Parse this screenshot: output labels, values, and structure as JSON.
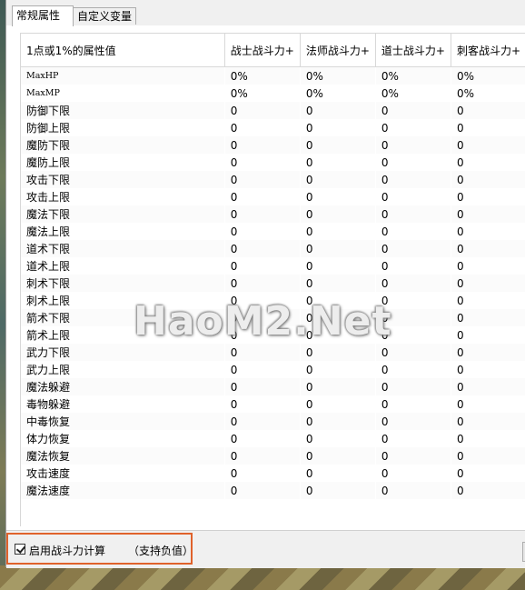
{
  "tabs": [
    {
      "label": "常规属性"
    },
    {
      "label": "自定义变量"
    }
  ],
  "table": {
    "columns": [
      "1点或1%的属性值",
      "战士战斗力+",
      "法师战斗力+",
      "道士战斗力+",
      "刺客战斗力+"
    ],
    "rows": [
      {
        "label": "MaxHP",
        "values": [
          "0%",
          "0%",
          "0%",
          "0%"
        ]
      },
      {
        "label": "MaxMP",
        "values": [
          "0%",
          "0%",
          "0%",
          "0%"
        ]
      },
      {
        "label": "防御下限",
        "values": [
          "0",
          "0",
          "0",
          "0"
        ]
      },
      {
        "label": "防御上限",
        "values": [
          "0",
          "0",
          "0",
          "0"
        ]
      },
      {
        "label": "魔防下限",
        "values": [
          "0",
          "0",
          "0",
          "0"
        ]
      },
      {
        "label": "魔防上限",
        "values": [
          "0",
          "0",
          "0",
          "0"
        ]
      },
      {
        "label": "攻击下限",
        "values": [
          "0",
          "0",
          "0",
          "0"
        ]
      },
      {
        "label": "攻击上限",
        "values": [
          "0",
          "0",
          "0",
          "0"
        ]
      },
      {
        "label": "魔法下限",
        "values": [
          "0",
          "0",
          "0",
          "0"
        ]
      },
      {
        "label": "魔法上限",
        "values": [
          "0",
          "0",
          "0",
          "0"
        ]
      },
      {
        "label": "道术下限",
        "values": [
          "0",
          "0",
          "0",
          "0"
        ]
      },
      {
        "label": "道术上限",
        "values": [
          "0",
          "0",
          "0",
          "0"
        ]
      },
      {
        "label": "刺术下限",
        "values": [
          "0",
          "0",
          "0",
          "0"
        ]
      },
      {
        "label": "刺术上限",
        "values": [
          "0",
          "0",
          "0",
          "0"
        ]
      },
      {
        "label": "箭术下限",
        "values": [
          "0",
          "0",
          "0",
          "0"
        ]
      },
      {
        "label": "箭术上限",
        "values": [
          "0",
          "0",
          "0",
          "0"
        ]
      },
      {
        "label": "武力下限",
        "values": [
          "0",
          "0",
          "0",
          "0"
        ]
      },
      {
        "label": "武力上限",
        "values": [
          "0",
          "0",
          "0",
          "0"
        ]
      },
      {
        "label": "魔法躲避",
        "values": [
          "0",
          "0",
          "0",
          "0"
        ]
      },
      {
        "label": "毒物躲避",
        "values": [
          "0",
          "0",
          "0",
          "0"
        ]
      },
      {
        "label": "中毒恢复",
        "values": [
          "0",
          "0",
          "0",
          "0"
        ]
      },
      {
        "label": "体力恢复",
        "values": [
          "0",
          "0",
          "0",
          "0"
        ]
      },
      {
        "label": "魔法恢复",
        "values": [
          "0",
          "0",
          "0",
          "0"
        ]
      },
      {
        "label": "攻击速度",
        "values": [
          "0",
          "0",
          "0",
          "0"
        ]
      },
      {
        "label": "魔法速度",
        "values": [
          "0",
          "0",
          "0",
          "0"
        ]
      }
    ]
  },
  "footer": {
    "enable_label": "启用战斗力计算",
    "hint": "（支持负值）",
    "checked": true
  },
  "watermark": "HaoM2.Net"
}
